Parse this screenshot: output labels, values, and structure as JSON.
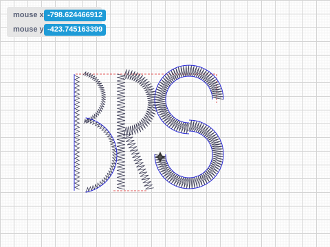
{
  "monitors": {
    "mouse_x": {
      "label": "mouse x",
      "value": "-798.624466912"
    },
    "mouse_y": {
      "label": "mouse y",
      "value": "-423.745163399"
    }
  },
  "colors": {
    "grid_line": "#d4d4d4",
    "fine_grid": "#ececec",
    "stitch_dark": "#3d3d55",
    "stitch_blue": "#2b2bd9",
    "guide_red": "#e05252",
    "monitor_bg": "#e6e6e6",
    "monitor_value_bg": "#1e9bd7",
    "monitor_label": "#575e75"
  },
  "stage": {
    "drawing_text": "BRS",
    "icons": [
      "crosshair-cursor-icon"
    ]
  }
}
